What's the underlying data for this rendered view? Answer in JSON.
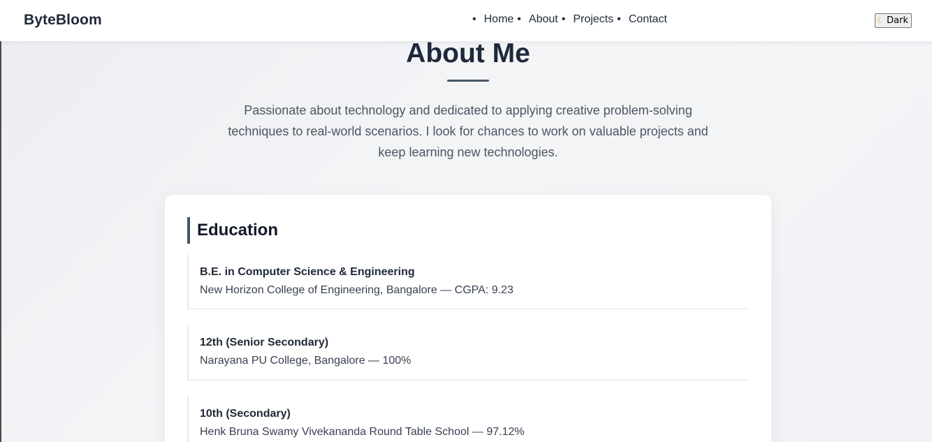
{
  "header": {
    "brand": "ByteBloom",
    "nav": [
      {
        "label": "Home"
      },
      {
        "label": "About"
      },
      {
        "label": "Projects"
      },
      {
        "label": "Contact"
      }
    ],
    "theme_toggle": {
      "label": "Dark",
      "icon": "moon-icon"
    }
  },
  "about": {
    "title": "About Me",
    "intro": "Passionate about technology and dedicated to applying creative problem-solving techniques to real-world scenarios. I look for chances to work on valuable projects and keep learning new technologies."
  },
  "education": {
    "heading": "Education",
    "items": [
      {
        "degree": "B.E. in Computer Science & Engineering",
        "detail": "New Horizon College of Engineering, Bangalore — CGPA: 9.23"
      },
      {
        "degree": "12th (Senior Secondary)",
        "detail": "Narayana PU College, Bangalore — 100%"
      },
      {
        "degree": "10th (Secondary)",
        "detail": "Henk Bruna Swamy Vivekananda Round Table School — 97.12%"
      }
    ]
  },
  "colors": {
    "accent": "#475569",
    "text": "#1f2937",
    "card_bg": "#ffffff"
  }
}
